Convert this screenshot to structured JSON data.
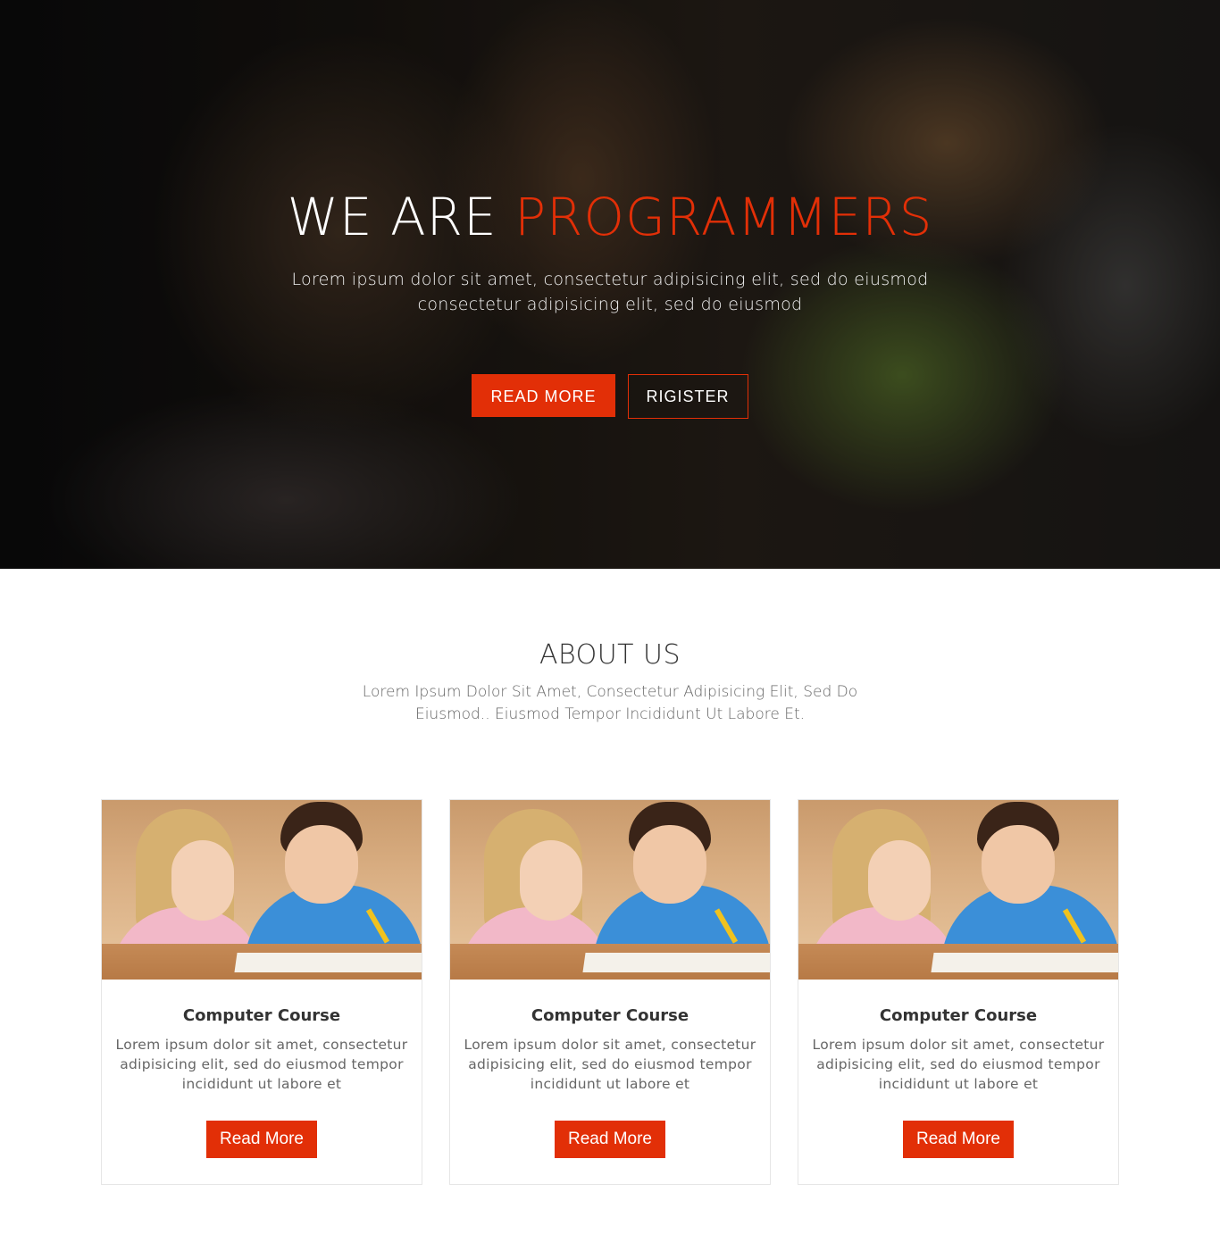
{
  "hero": {
    "title_prefix": "WE ARE",
    "title_accent": "PROGRAMMERS",
    "subtitle": "Lorem ipsum dolor sit amet, consectetur adipisicing elit, sed do eiusmod consectetur adipisicing elit, sed do eiusmod",
    "primary_button": "READ MORE",
    "secondary_button": "RIGISTER"
  },
  "about": {
    "title": "ABOUT US",
    "subtitle": "Lorem Ipsum Dolor Sit Amet, Consectetur Adipisicing Elit, Sed Do Eiusmod.. Eiusmod Tempor Incididunt Ut Labore Et."
  },
  "cards": [
    {
      "title": "Computer Course",
      "text": "Lorem ipsum dolor sit amet, consectetur adipisicing elit, sed do eiusmod tempor incididunt ut labore et",
      "button": "Read More"
    },
    {
      "title": "Computer Course",
      "text": "Lorem ipsum dolor sit amet, consectetur adipisicing elit, sed do eiusmod tempor incididunt ut labore et",
      "button": "Read More"
    },
    {
      "title": "Computer Course",
      "text": "Lorem ipsum dolor sit amet, consectetur adipisicing elit, sed do eiusmod tempor incididunt ut labore et",
      "button": "Read More"
    }
  ],
  "colors": {
    "accent": "#e22f07",
    "text_dark": "#333333",
    "text_muted": "#666666"
  }
}
